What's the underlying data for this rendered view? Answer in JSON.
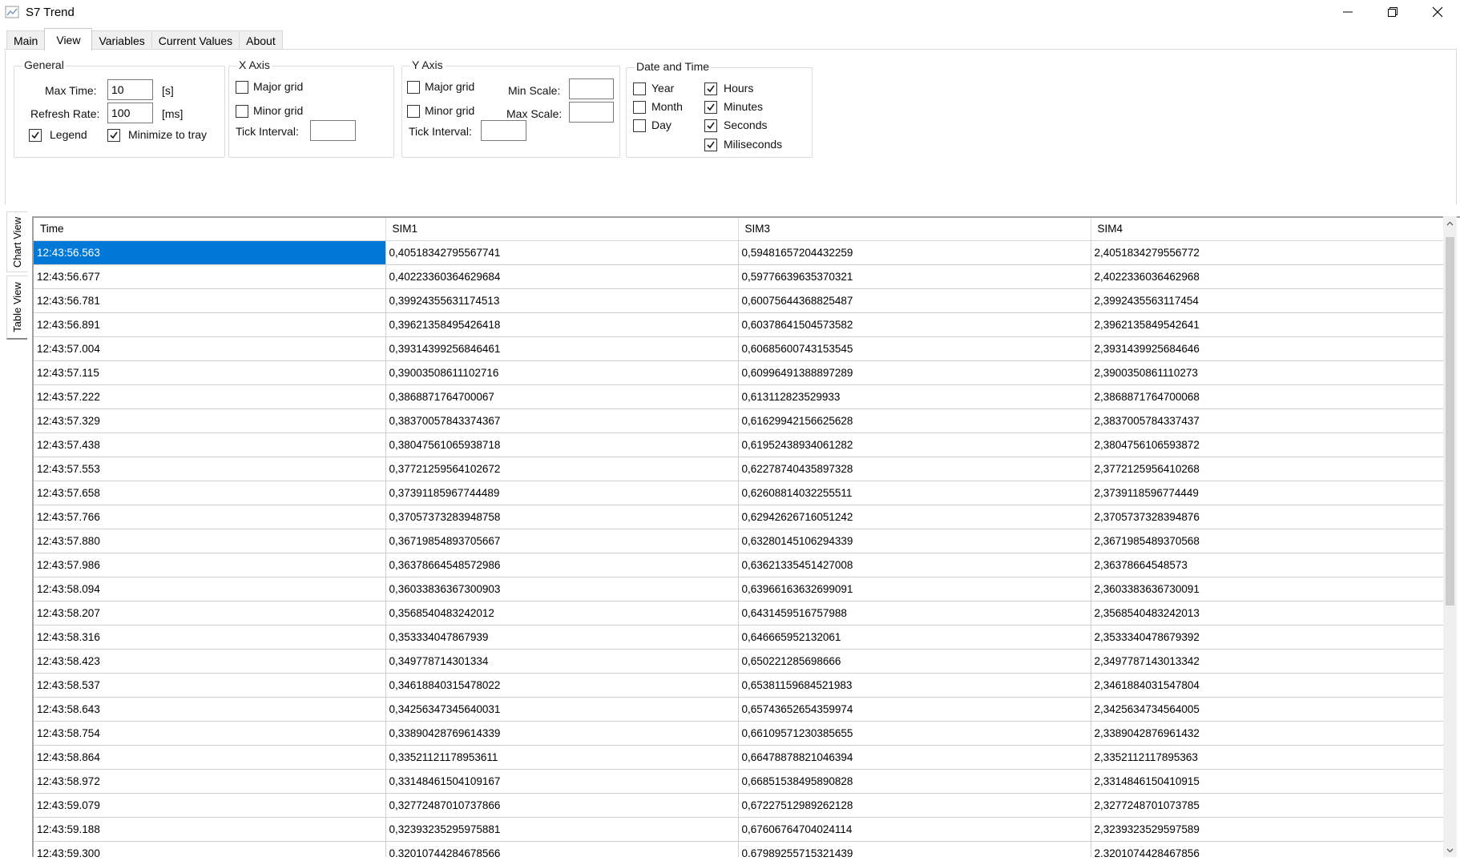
{
  "window": {
    "title": "S7 Trend"
  },
  "tabs": [
    {
      "label": "Main",
      "active": false
    },
    {
      "label": "View",
      "active": true
    },
    {
      "label": "Variables",
      "active": false
    },
    {
      "label": "Current Values",
      "active": false
    },
    {
      "label": "About",
      "active": false
    }
  ],
  "general": {
    "title": "General",
    "max_time_label": "Max Time:",
    "max_time_value": "10",
    "max_time_unit": "[s]",
    "refresh_rate_label": "Refresh Rate:",
    "refresh_rate_value": "100",
    "refresh_rate_unit": "[ms]",
    "legend_label": "Legend",
    "legend_checked": true,
    "minimize_label": "Minimize to tray",
    "minimize_checked": true
  },
  "x_axis": {
    "title": "X Axis",
    "major_grid_label": "Major grid",
    "major_grid_checked": false,
    "minor_grid_label": "Minor grid",
    "minor_grid_checked": false,
    "tick_interval_label": "Tick Interval:",
    "tick_interval_value": ""
  },
  "y_axis": {
    "title": "Y Axis",
    "major_grid_label": "Major grid",
    "major_grid_checked": false,
    "minor_grid_label": "Minor grid",
    "minor_grid_checked": false,
    "min_scale_label": "Min Scale:",
    "min_scale_value": "",
    "max_scale_label": "Max Scale:",
    "max_scale_value": "",
    "tick_interval_label": "Tick Interval:",
    "tick_interval_value": ""
  },
  "date_time": {
    "title": "Date and Time",
    "year_label": "Year",
    "year_checked": false,
    "month_label": "Month",
    "month_checked": false,
    "day_label": "Day",
    "day_checked": false,
    "hours_label": "Hours",
    "hours_checked": true,
    "minutes_label": "Minutes",
    "minutes_checked": true,
    "seconds_label": "Seconds",
    "seconds_checked": true,
    "milliseconds_label": "Miliseconds",
    "milliseconds_checked": true
  },
  "side_tabs": {
    "chart_view": "Chart View",
    "table_view": "Table View"
  },
  "table": {
    "columns": [
      "Time",
      "SIM1",
      "SIM3",
      "SIM4"
    ],
    "rows": [
      [
        "12:43:56.563",
        "0,40518342795567741",
        "0,59481657204432259",
        "2,4051834279556772"
      ],
      [
        "12:43:56.677",
        "0,40223360364629684",
        "0,59776639635370321",
        "2,4022336036462968"
      ],
      [
        "12:43:56.781",
        "0,39924355631174513",
        "0,60075644368825487",
        "2,3992435563117454"
      ],
      [
        "12:43:56.891",
        "0,39621358495426418",
        "0,60378641504573582",
        "2,3962135849542641"
      ],
      [
        "12:43:57.004",
        "0,39314399256846461",
        "0,60685600743153545",
        "2,3931439925684646"
      ],
      [
        "12:43:57.115",
        "0,39003508611102716",
        "0,60996491388897289",
        "2,3900350861110273"
      ],
      [
        "12:43:57.222",
        "0,3868871764700067",
        "0,613112823529933",
        "2,3868871764700068"
      ],
      [
        "12:43:57.329",
        "0,38370057843374367",
        "0,61629942156625628",
        "2,3837005784337437"
      ],
      [
        "12:43:57.438",
        "0,38047561065938718",
        "0,61952438934061282",
        "2,3804756106593872"
      ],
      [
        "12:43:57.553",
        "0,37721259564102672",
        "0,62278740435897328",
        "2,3772125956410268"
      ],
      [
        "12:43:57.658",
        "0,37391185967744489",
        "0,62608814032255511",
        "2,3739118596774449"
      ],
      [
        "12:43:57.766",
        "0,37057373283948758",
        "0,62942626716051242",
        "2,3705737328394876"
      ],
      [
        "12:43:57.880",
        "0,36719854893705667",
        "0,63280145106294339",
        "2,3671985489370568"
      ],
      [
        "12:43:57.986",
        "0,36378664548572986",
        "0,63621335451427008",
        "2,36378664548573"
      ],
      [
        "12:43:58.094",
        "0,36033836367300903",
        "0,63966163632699091",
        "2,3603383636730091"
      ],
      [
        "12:43:58.207",
        "0,3568540483242012",
        "0,6431459516757988",
        "2,3568540483242013"
      ],
      [
        "12:43:58.316",
        "0,353334047867939",
        "0,646665952132061",
        "2,3533340478679392"
      ],
      [
        "12:43:58.423",
        "0,349778714301334",
        "0,650221285698666",
        "2,3497787143013342"
      ],
      [
        "12:43:58.537",
        "0,34618840315478022",
        "0,65381159684521983",
        "2,3461884031547804"
      ],
      [
        "12:43:58.643",
        "0,34256347345640031",
        "0,65743652654359974",
        "2,3425634734564005"
      ],
      [
        "12:43:58.754",
        "0,33890428769614339",
        "0,66109571230385655",
        "2,3389042876961432"
      ],
      [
        "12:43:58.864",
        "0,33521121178953611",
        "0,66478878821046394",
        "2,3352112117895363"
      ],
      [
        "12:43:58.972",
        "0,33148461504109167",
        "0,66851538495890828",
        "2,3314846150410915"
      ],
      [
        "12:43:59.079",
        "0,32772487010737866",
        "0,67227512989262128",
        "2,3277248701073785"
      ],
      [
        "12:43:59.188",
        "0,32393235295975881",
        "0,67606764704024114",
        "2,3239323529597589"
      ],
      [
        "12:43:59.300",
        "0,32010744284678566",
        "0,67989255715321439",
        "2,3201074428467856"
      ]
    ],
    "selected_row": 0
  },
  "colors": {
    "selection": "#0078d7",
    "accent_check": "#1a1a1a"
  }
}
